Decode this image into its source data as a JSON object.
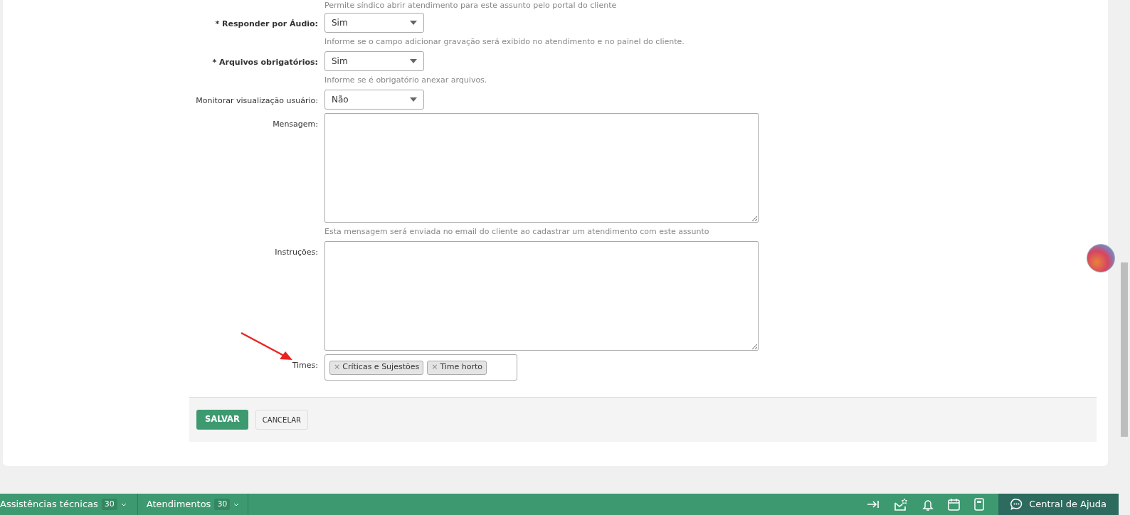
{
  "top_hint": "Permite síndico abrir atendimento para este assunto pelo portal do cliente",
  "fields": [
    {
      "kind": "select",
      "label": "Responder por Áudio:",
      "required_mark": "*",
      "value": "Sim",
      "hint": "Informe se o campo adicionar gravação será exibido no atendimento e no painel do cliente."
    },
    {
      "kind": "select",
      "label": "Arquivos obrigatórios:",
      "required_mark": "*",
      "value": "Sim",
      "hint": "Informe se é obrigatório anexar arquivos."
    },
    {
      "kind": "select",
      "label": "Monitorar visualização usuário:",
      "value": "Não"
    },
    {
      "kind": "textarea",
      "label": "Mensagem:",
      "hint": "Esta mensagem será enviada no email do cliente ao cadastrar um atendimento com este assunto"
    },
    {
      "kind": "textarea",
      "label": "Instruções:"
    },
    {
      "kind": "tags",
      "label": "Times:",
      "tags": [
        {
          "remove": "×",
          "label": "Críticas e Sujestões"
        },
        {
          "remove": "×",
          "label": "Time horto"
        }
      ]
    }
  ],
  "buttons": [
    {
      "label": "SALVAR",
      "kind": "primary"
    },
    {
      "label": "CANCELAR",
      "kind": "secondary"
    }
  ],
  "bottom_bar": {
    "items": [
      {
        "label": "Assistências técnicas",
        "count": "30"
      },
      {
        "label": "Atendimentos",
        "count": "30"
      }
    ],
    "help": "Central de Ajuda"
  }
}
